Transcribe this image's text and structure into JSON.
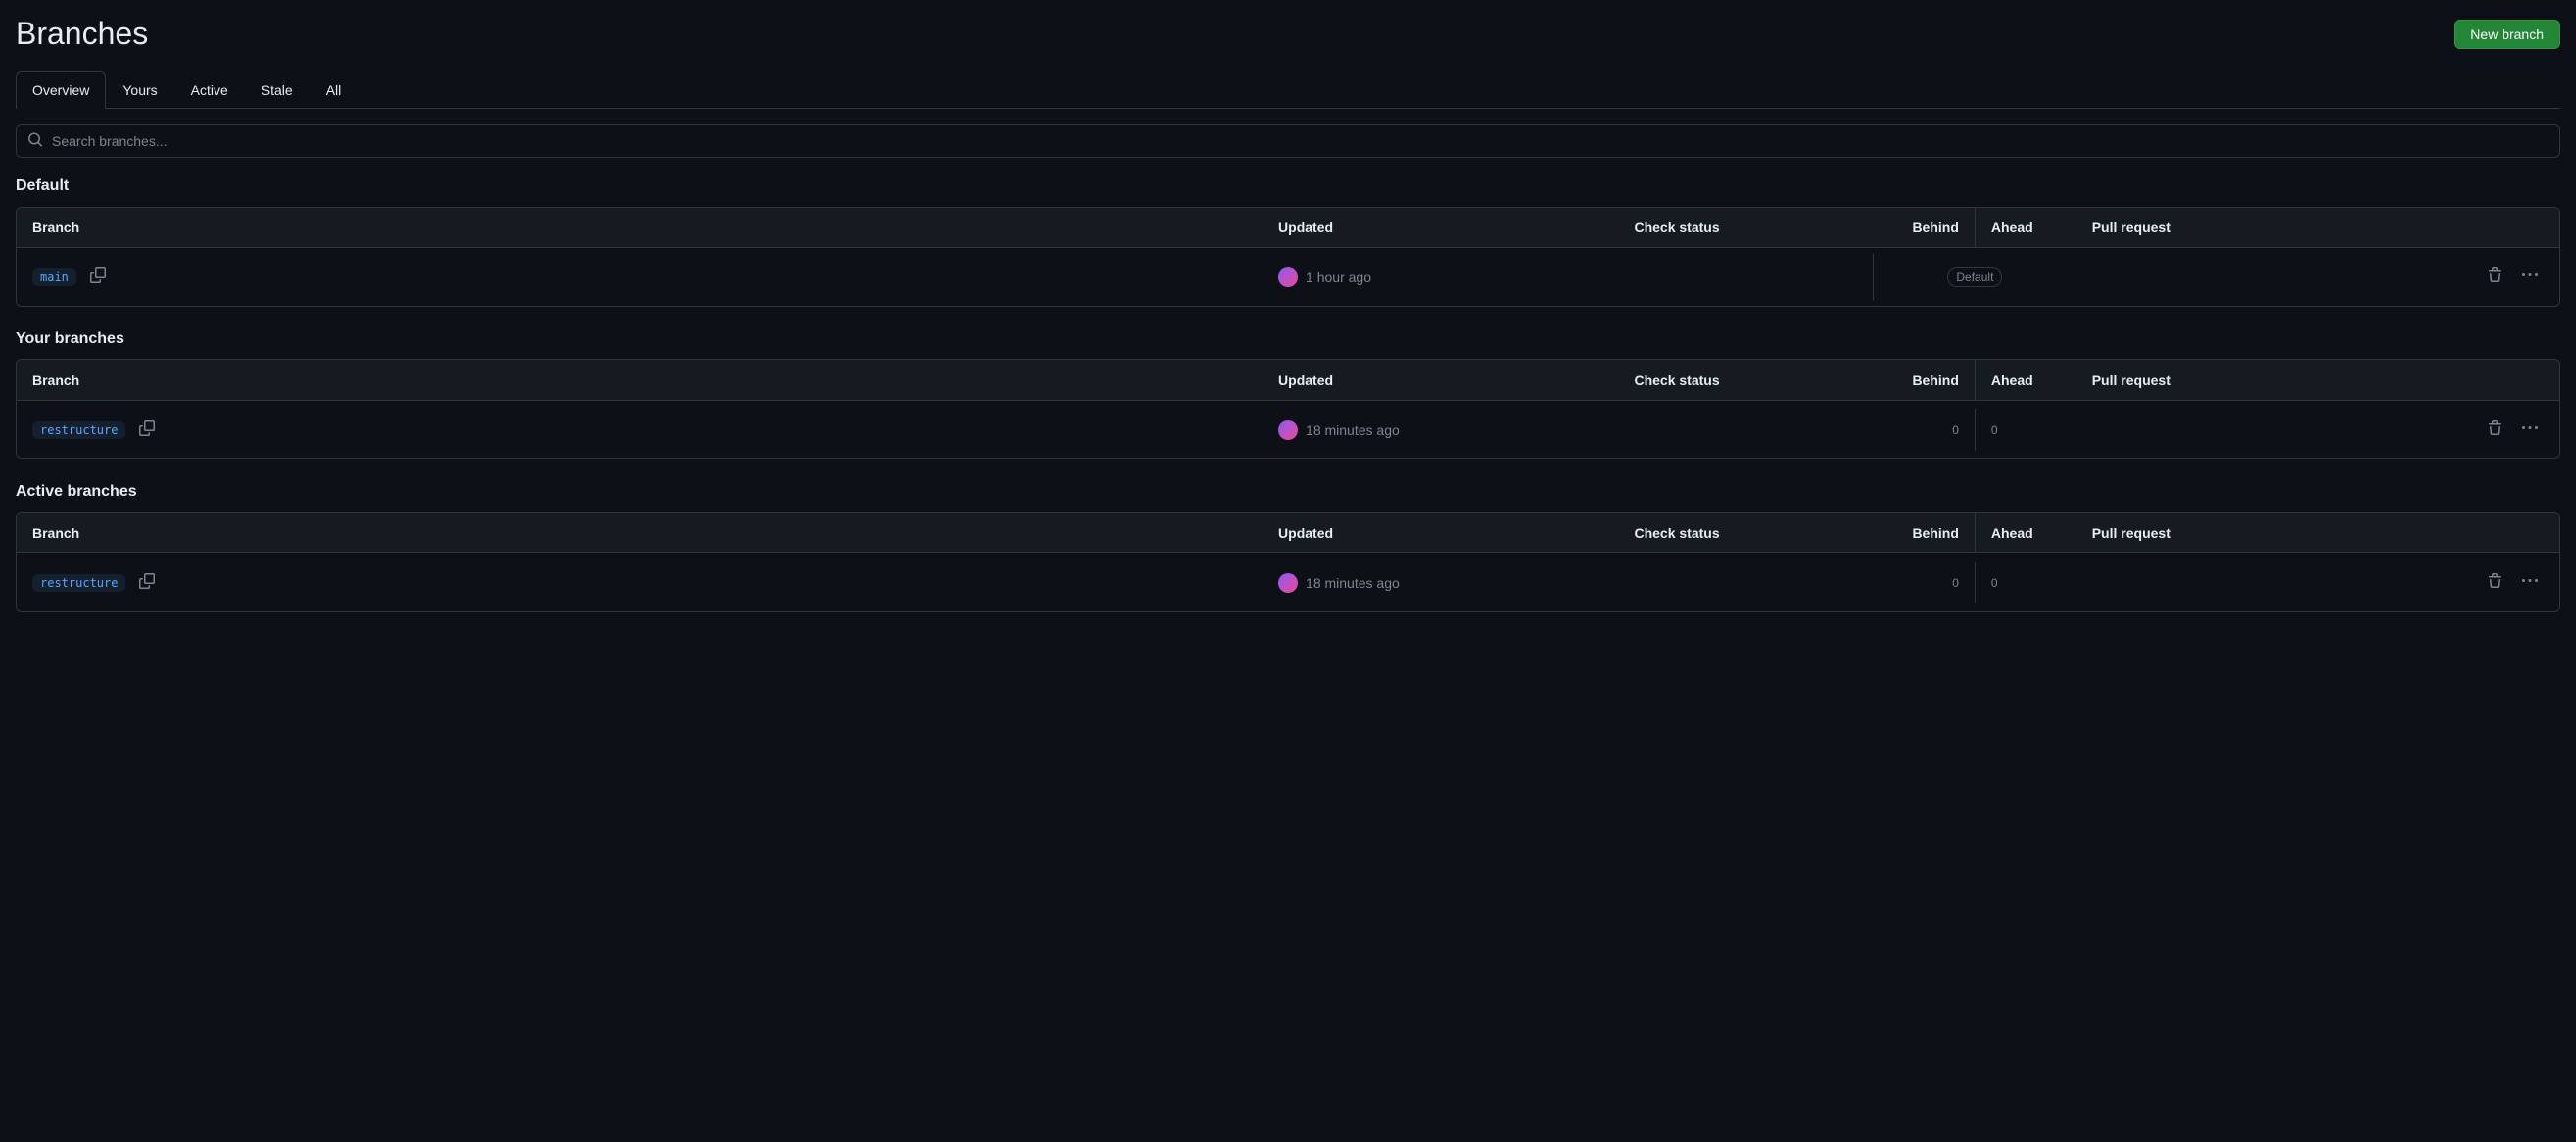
{
  "page_title": "Branches",
  "new_branch_label": "New branch",
  "tabs": [
    {
      "label": "Overview",
      "active": true
    },
    {
      "label": "Yours",
      "active": false
    },
    {
      "label": "Active",
      "active": false
    },
    {
      "label": "Stale",
      "active": false
    },
    {
      "label": "All",
      "active": false
    }
  ],
  "search": {
    "placeholder": "Search branches..."
  },
  "columns": {
    "branch": "Branch",
    "updated": "Updated",
    "check_status": "Check status",
    "behind": "Behind",
    "ahead": "Ahead",
    "pull_request": "Pull request"
  },
  "sections": [
    {
      "title": "Default",
      "rows": [
        {
          "branch": "main",
          "updated": "1 hour ago",
          "default_badge": "Default",
          "behind": null,
          "ahead": null
        }
      ]
    },
    {
      "title": "Your branches",
      "rows": [
        {
          "branch": "restructure",
          "updated": "18 minutes ago",
          "default_badge": null,
          "behind": "0",
          "ahead": "0"
        }
      ]
    },
    {
      "title": "Active branches",
      "rows": [
        {
          "branch": "restructure",
          "updated": "18 minutes ago",
          "default_badge": null,
          "behind": "0",
          "ahead": "0"
        }
      ]
    }
  ]
}
